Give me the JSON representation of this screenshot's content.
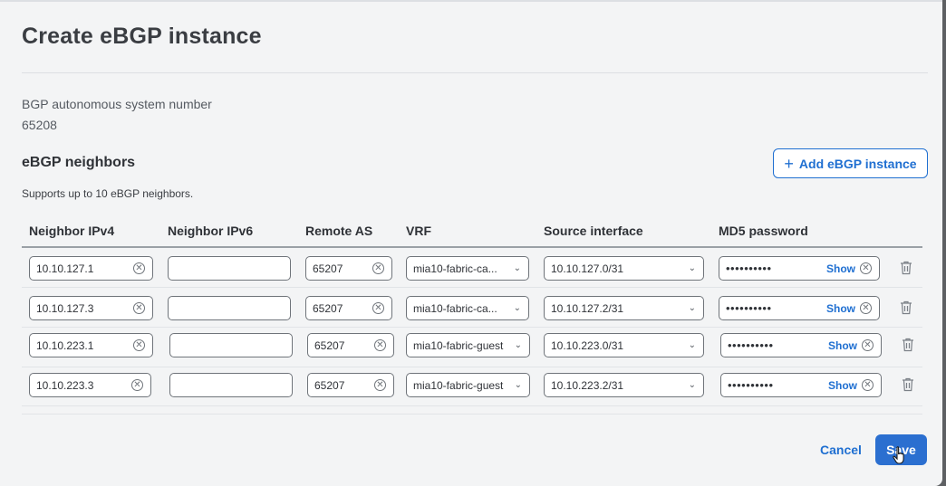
{
  "dialog": {
    "title": "Create eBGP instance",
    "asn_label": "BGP autonomous system number",
    "asn_value": "65208",
    "neighbors_title": "eBGP neighbors",
    "neighbors_subtitle": "Supports up to 10 eBGP neighbors.",
    "add_button": "Add eBGP instance"
  },
  "table": {
    "headers": [
      "Neighbor IPv4",
      "Neighbor IPv6",
      "Remote AS",
      "VRF",
      "Source interface",
      "MD5 password"
    ],
    "rows": [
      {
        "ipv4": "10.10.127.1",
        "ipv6": "",
        "remote_as": "65207",
        "vrf": "mia10-fabric-ca...",
        "source": "10.10.127.0/31",
        "password": "••••••••••",
        "show": "Show"
      },
      {
        "ipv4": "10.10.127.3",
        "ipv6": "",
        "remote_as": "65207",
        "vrf": "mia10-fabric-ca...",
        "source": "10.10.127.2/31",
        "password": "••••••••••",
        "show": "Show"
      },
      {
        "ipv4": "10.10.223.1",
        "ipv6": "",
        "remote_as": "65207",
        "vrf": "mia10-fabric-guest",
        "source": "10.10.223.0/31",
        "password": "••••••••••",
        "show": "Show"
      },
      {
        "ipv4": "10.10.223.3",
        "ipv6": "",
        "remote_as": "65207",
        "vrf": "mia10-fabric-guest",
        "source": "10.10.223.2/31",
        "password": "••••••••••",
        "show": "Show"
      }
    ]
  },
  "footer": {
    "cancel": "Cancel",
    "save": "Save"
  },
  "colors": {
    "accent": "#1f6fd1",
    "save_bg": "#2b6fd0",
    "backdrop": "#5e6063"
  }
}
